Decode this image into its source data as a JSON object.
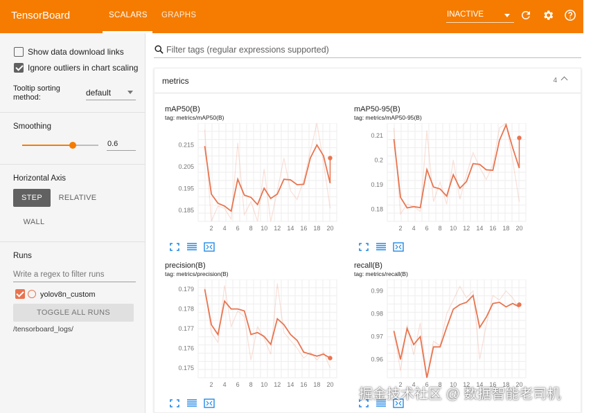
{
  "header": {
    "brand": "TensorBoard",
    "tabs": [
      {
        "label": "SCALARS"
      },
      {
        "label": "GRAPHS"
      }
    ],
    "run_state": "INACTIVE",
    "icons": [
      "refresh-icon",
      "gear-icon",
      "help-icon"
    ]
  },
  "sidebar": {
    "show_download_label": "Show data download links",
    "show_download_checked": false,
    "ignore_outliers_label": "Ignore outliers in chart scaling",
    "ignore_outliers_checked": true,
    "tooltip_label_1": "Tooltip sorting",
    "tooltip_label_2": "method:",
    "tooltip_value": "default",
    "smoothing_label": "Smoothing",
    "smoothing_value": "0.6",
    "smoothing_level": 0.6,
    "axis_label": "Horizontal Axis",
    "axis_options": [
      "STEP",
      "RELATIVE",
      "WALL"
    ],
    "axis_selected": "STEP",
    "runs_label": "Runs",
    "runs_placeholder": "Write a regex to filter runs",
    "run_name": "yolov8n_custom",
    "toggle_label": "TOGGLE ALL RUNS",
    "logdir": "/tensorboard_logs/"
  },
  "main": {
    "filter_placeholder": "Filter tags (regular expressions supported)",
    "category": {
      "name": "metrics",
      "count": "4"
    }
  },
  "colors": {
    "accent": "#f57c00",
    "run": "#e8744f"
  },
  "watermark": "掘金技术社区 @ 数据智能老司机",
  "chart_data": [
    {
      "type": "line",
      "title": "mAP50(B)",
      "tag": "tag: metrics/mAP50(B)",
      "x": [
        1,
        2,
        3,
        4,
        5,
        6,
        7,
        8,
        9,
        10,
        11,
        12,
        13,
        14,
        15,
        16,
        17,
        18,
        19,
        20
      ],
      "raw": [
        0.222,
        0.18,
        0.187,
        0.186,
        0.181,
        0.216,
        0.183,
        0.189,
        0.178,
        0.204,
        0.18,
        0.194,
        0.209,
        0.194,
        0.19,
        0.199,
        0.212,
        0.229,
        0.207,
        0.186
      ],
      "smoothed": [
        0.2145,
        0.1925,
        0.1883,
        0.187,
        0.1847,
        0.1993,
        0.192,
        0.191,
        0.1877,
        0.1952,
        0.1905,
        0.1925,
        0.1993,
        0.199,
        0.1968,
        0.197,
        0.209,
        0.215,
        0.21,
        0.1975
      ],
      "last_point": [
        20,
        0.209
      ],
      "ylim": [
        0.18,
        0.225
      ],
      "yticks": [
        "0.215",
        "0.205",
        "0.195",
        "0.185"
      ],
      "xticks": [
        "2",
        "4",
        "6",
        "8",
        "10",
        "12",
        "14",
        "16",
        "18",
        "20"
      ]
    },
    {
      "type": "line",
      "title": "mAP50-95(B)",
      "tag": "tag: metrics/mAP50-95(B)",
      "x": [
        1,
        2,
        3,
        4,
        5,
        6,
        7,
        8,
        9,
        10,
        11,
        12,
        13,
        14,
        15,
        16,
        17,
        18,
        19,
        20
      ],
      "raw": [
        0.213,
        0.178,
        0.182,
        0.181,
        0.179,
        0.212,
        0.183,
        0.191,
        0.182,
        0.2,
        0.184,
        0.194,
        0.203,
        0.197,
        0.192,
        0.198,
        0.213,
        0.221,
        0.2,
        0.183
      ],
      "smoothed": [
        0.2085,
        0.1848,
        0.1805,
        0.181,
        0.1806,
        0.1961,
        0.189,
        0.1882,
        0.1853,
        0.194,
        0.1885,
        0.1912,
        0.1985,
        0.1982,
        0.196,
        0.1958,
        0.208,
        0.2143,
        0.205,
        0.1967
      ],
      "last_point": [
        20,
        0.209
      ],
      "ylim": [
        0.175,
        0.215
      ],
      "yticks": [
        "0.21",
        "0.2",
        "0.19",
        "0.18"
      ],
      "xticks": [
        "2",
        "4",
        "6",
        "8",
        "10",
        "12",
        "14",
        "16",
        "18",
        "20"
      ]
    },
    {
      "type": "line",
      "title": "precision(B)",
      "tag": "tag: metrics/precision(B)",
      "x": [
        1,
        2,
        3,
        4,
        5,
        6,
        7,
        8,
        9,
        10,
        11,
        12,
        13,
        14,
        15,
        16,
        17,
        18,
        19,
        20
      ],
      "raw": [
        0.1791,
        0.1768,
        0.1763,
        0.1792,
        0.1771,
        0.1779,
        0.1776,
        0.1754,
        0.1771,
        0.1765,
        0.1757,
        0.1793,
        0.1768,
        0.1764,
        0.176,
        0.1755,
        0.1758,
        0.1754,
        0.1758,
        0.175
      ],
      "smoothed": [
        0.179,
        0.1772,
        0.1767,
        0.1784,
        0.178,
        0.178,
        0.1779,
        0.1767,
        0.1768,
        0.1766,
        0.1762,
        0.1775,
        0.1772,
        0.1767,
        0.1764,
        0.1758,
        0.1757,
        0.1756,
        0.1757,
        0.1755
      ],
      "last_point": [
        20,
        0.1755
      ],
      "ylim": [
        0.1745,
        0.1795
      ],
      "yticks": [
        "0.179",
        "0.178",
        "0.177",
        "0.176",
        "0.175"
      ],
      "xticks": [
        "2",
        "4",
        "6",
        "8",
        "10",
        "12",
        "14",
        "16",
        "18",
        "20"
      ]
    },
    {
      "type": "line",
      "title": "recall(B)",
      "tag": "tag: metrics/recall(B)",
      "x": [
        1,
        2,
        3,
        4,
        5,
        6,
        7,
        8,
        9,
        10,
        11,
        12,
        13,
        14,
        15,
        16,
        17,
        18,
        19,
        20
      ],
      "raw": [
        0.972,
        0.955,
        0.975,
        0.962,
        0.976,
        0.94,
        0.968,
        0.966,
        0.98,
        0.986,
        0.992,
        0.987,
        0.99,
        0.96,
        0.975,
        0.988,
        0.986,
        0.99,
        0.987,
        0.982
      ],
      "smoothed": [
        0.9725,
        0.96,
        0.9735,
        0.9665,
        0.97,
        0.952,
        0.9655,
        0.9655,
        0.974,
        0.982,
        0.984,
        0.985,
        0.988,
        0.974,
        0.9785,
        0.9845,
        0.985,
        0.983,
        0.9845,
        0.983
      ],
      "last_point": [
        20,
        0.984
      ],
      "ylim": [
        0.952,
        0.995
      ],
      "yticks": [
        "0.99",
        "0.98",
        "0.97",
        "0.96"
      ],
      "xticks": [
        "2",
        "4",
        "6",
        "8",
        "10",
        "12",
        "14",
        "16",
        "18",
        "20"
      ]
    }
  ]
}
